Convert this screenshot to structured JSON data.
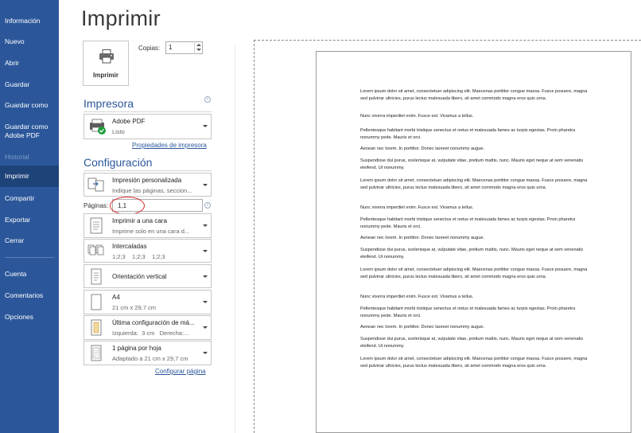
{
  "sidebar": {
    "items": [
      {
        "label": "Información"
      },
      {
        "label": "Nuevo"
      },
      {
        "label": "Abrir"
      },
      {
        "label": "Guardar"
      },
      {
        "label": "Guardar como"
      },
      {
        "label": "Guardar como Adobe PDF"
      },
      {
        "label": "Historial"
      },
      {
        "label": "Imprimir"
      },
      {
        "label": "Compartir"
      },
      {
        "label": "Exportar"
      },
      {
        "label": "Cerrar"
      },
      {
        "label": "Cuenta"
      },
      {
        "label": "Comentarios"
      },
      {
        "label": "Opciones"
      }
    ]
  },
  "main": {
    "title": "Imprimir",
    "print_button": {
      "label": "Imprimir",
      "icon": "printer-icon"
    },
    "copies": {
      "label": "Copias:",
      "value": "1"
    },
    "printer": {
      "heading": "Impresora",
      "name": "Adobe PDF",
      "status": "Listo",
      "properties_link": "Propiedades de impresora"
    },
    "settings": {
      "heading": "Configuración",
      "range": {
        "title": "Impresión personalizada",
        "subtitle": "Indique las páginas, seccion..."
      },
      "pages": {
        "label": "Páginas:",
        "value": "1,1"
      },
      "sides": {
        "title": "Imprimir a una cara",
        "subtitle": "Imprime solo en una cara d..."
      },
      "collation": {
        "title": "Intercaladas",
        "subtitle": "1;2;3    1;2;3    1;2;3"
      },
      "orientation": {
        "title": "Orientación vertical"
      },
      "paper": {
        "title": "A4",
        "subtitle": "21 cm x 29,7 cm"
      },
      "margins": {
        "title": "Última configuración de má...",
        "subtitle": "Izquierda:  3 cm   Derecha:..."
      },
      "per_sheet": {
        "title": "1 página por hoja",
        "subtitle": "Adaptado a 21 cm x 29,7 cm"
      },
      "page_setup_link": "Configurar página"
    }
  },
  "preview": {
    "paragraphs": [
      "Lorem ipsum dolor sit amet, consectetuer adipiscing elit. Maecenas porttitor congue massa. Fusce posuere, magna sed pulvinar ultricies, purus lectus malesuada libero, sit amet commodo magna eros quis urna.",
      "Nunc viverra imperdiet enim. Fusce est. Vivamus a tellus.",
      "Pellentesque habitant morbi tristique senectus et netus et malesuada fames ac turpis egestas. Proin pharetra nonummy pede. Mauris et orci.",
      "Aenean nec lorem. In porttitor. Donec laoreet nonummy augue.",
      "Suspendisse dui purus, scelerisque at, vulputate vitae, pretium mattis, nunc. Mauris eget neque at sem venenatis eleifend. Ut nonummy.",
      "Lorem ipsum dolor sit amet, consectetuer adipiscing elit. Maecenas porttitor congue massa. Fusce posuere, magna sed pulvinar ultricies, purus lectus malesuada libero, sit amet commodo magna eros quis urna.",
      "Nunc viverra imperdiet enim. Fusce est. Vivamus a tellus.",
      "Pellentesque habitant morbi tristique senectus et netus et malesuada fames ac turpis egestas. Proin pharetra nonummy pede. Mauris et orci.",
      "Aenean nec lorem. In porttitor. Donec laoreet nonummy augue.",
      "Suspendisse dui purus, scelerisque at, vulputate vitae, pretium mattis, nunc. Mauris eget neque at sem venenatis eleifend. Ut nonummy.",
      "Lorem ipsum dolor sit amet, consectetuer adipiscing elit. Maecenas porttitor congue massa. Fusce posuere, magna sed pulvinar ultricies, purus lectus malesuada libero, sit amet commodo magna eros quis urna.",
      "Nunc viverra imperdiet enim. Fusce est. Vivamus a tellus.",
      "Pellentesque habitant morbi tristique senectus et netus et malesuada fames ac turpis egestas. Proin pharetra nonummy pede. Mauris et orci.",
      "Aenean nec lorem. In porttitor. Donec laoreet nonummy augue.",
      "Suspendisse dui purus, scelerisque at, vulputate vitae, pretium mattis, nunc. Mauris eget neque at sem venenatis eleifend. Ut nonummy.",
      "Lorem ipsum dolor sit amet, consectetuer adipiscing elit. Maecenas porttitor congue massa. Fusce posuere, magna sed pulvinar ultricies, purus lectus malesuada libero, sit amet commodo magna eros quis urna."
    ]
  },
  "colors": {
    "sidebar": "#2b579a",
    "sidebar_selected": "#1e4379",
    "accent": "#2b579a",
    "annotation": "#d92b2b"
  }
}
